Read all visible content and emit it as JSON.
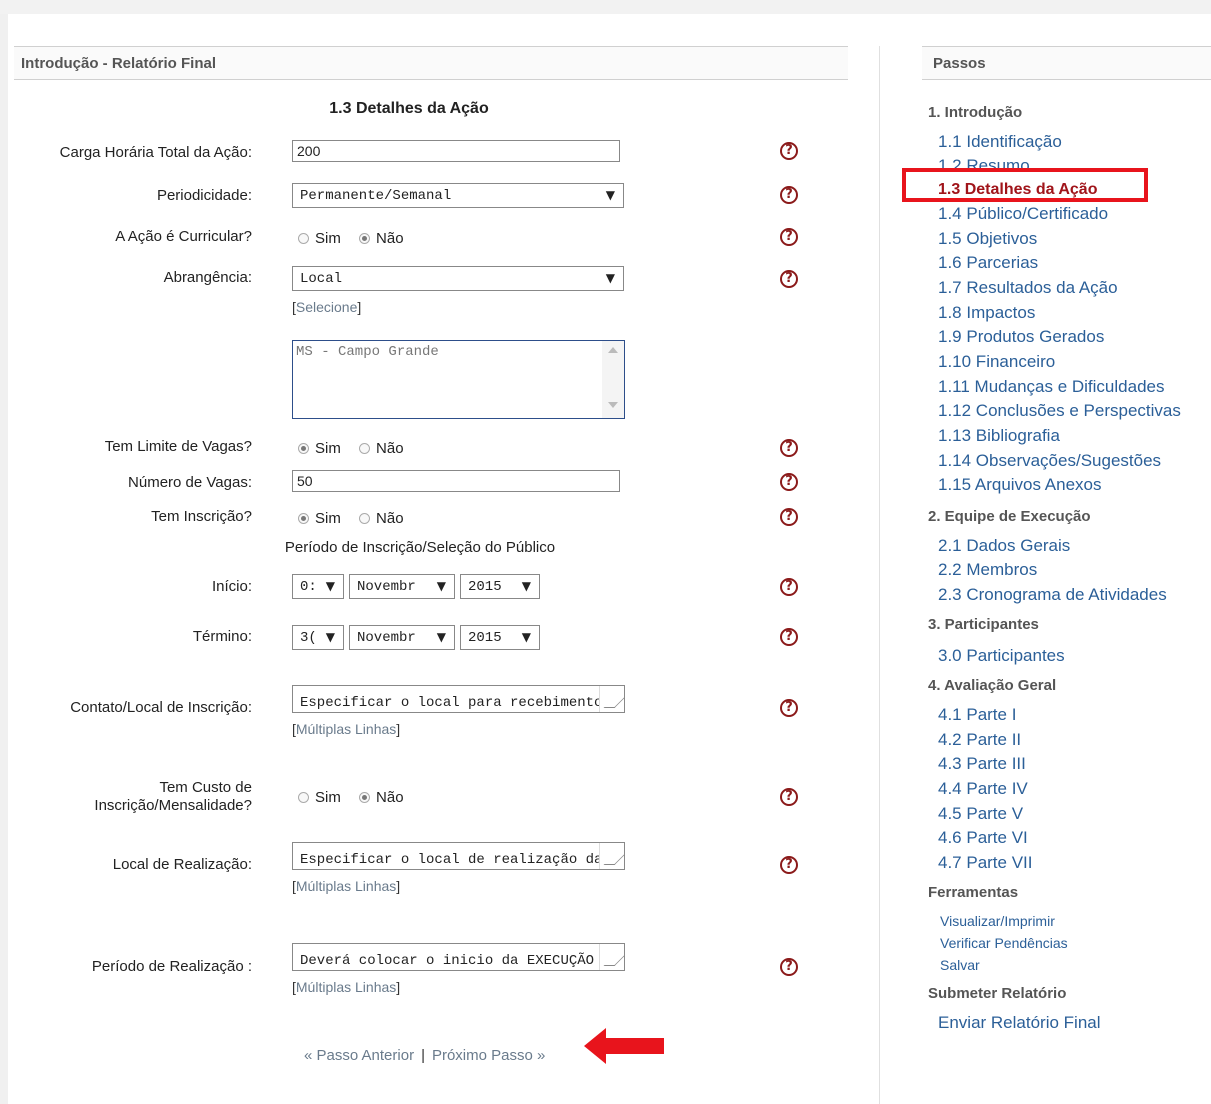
{
  "main": {
    "panel_title": "Introdução - Relatório Final",
    "section_title": "1.3 Detalhes da Ação",
    "fields": {
      "carga_label": "Carga Horária Total da Ação:",
      "carga_value": "200",
      "periodicidade_label": "Periodicidade:",
      "periodicidade_value": "Permanente/Semanal",
      "curricular_label": "A Ação é Curricular?",
      "abrangencia_label": "Abrangência:",
      "abrangencia_value": "Local",
      "selecione_link": "Selecione",
      "abrangencia_list_value": "MS - Campo Grande",
      "limite_label": "Tem Limite de Vagas?",
      "vagas_label": "Número de Vagas:",
      "vagas_value": "50",
      "inscricao_label": "Tem Inscrição?",
      "periodo_inscricao_label": "Período de Inscrição/Seleção do Público",
      "inicio_label": "Início:",
      "inicio_day": "0:",
      "inicio_month": "Novembr",
      "inicio_year": "2015",
      "termino_label": "Término:",
      "termino_day": "3(",
      "termino_month": "Novembr",
      "termino_year": "2015",
      "contato_label": "Contato/Local de Inscrição:",
      "contato_value": "Especificar o local para recebimento das",
      "custo_label_line1": "Tem Custo de",
      "custo_label_line2": "Inscrição/Mensalidade?",
      "local_label": "Local de Realização:",
      "local_value": "Especificar o local de realização das",
      "periodo_label": "Período de Realização :",
      "periodo_value": "Deverá colocar o inicio da EXECUÇÃO",
      "multiplas_link": "Múltiplas Linhas"
    },
    "radio": {
      "sim": "Sim",
      "nao": "Não"
    },
    "help_glyph": "?",
    "pager": {
      "prev": "« Passo Anterior",
      "sep": "|",
      "next": "Próximo Passo »"
    }
  },
  "sidebar": {
    "title": "Passos",
    "groups": {
      "g1": "1. Introdução",
      "g2": "2. Equipe de Execução",
      "g3": "3. Participantes",
      "g4": "4. Avaliação Geral",
      "g5": "Ferramentas",
      "g6": "Submeter Relatório"
    },
    "steps": [
      "1.1 Identificação",
      "1.2 Resumo",
      "1.3 Detalhes da Ação",
      "1.4 Público/Certificado",
      "1.5 Objetivos",
      "1.6 Parcerias",
      "1.7 Resultados da Ação",
      "1.8 Impactos",
      "1.9 Produtos Gerados",
      "1.10 Financeiro",
      "1.11 Mudanças e Dificuldades",
      "1.12 Conclusões e Perspectivas",
      "1.13 Bibliografia",
      "1.14 Observações/Sugestões",
      "1.15 Arquivos Anexos",
      "2.1 Dados Gerais",
      "2.2 Membros",
      "2.3 Cronograma de Atividades",
      "3.0 Participantes",
      "4.1 Parte I",
      "4.2 Parte II",
      "4.3 Parte III",
      "4.4 Parte IV",
      "4.5 Parte V",
      "4.6 Parte VI",
      "4.7 Parte VII"
    ],
    "tools": [
      "Visualizar/Imprimir",
      "Verificar Pendências",
      "Salvar"
    ],
    "submit": "Enviar Relatório Final"
  },
  "colors": {
    "active_step": "#a0141a",
    "link": "#2b5f98",
    "highlight": "#e8141c",
    "help": "#8b1a1a"
  }
}
